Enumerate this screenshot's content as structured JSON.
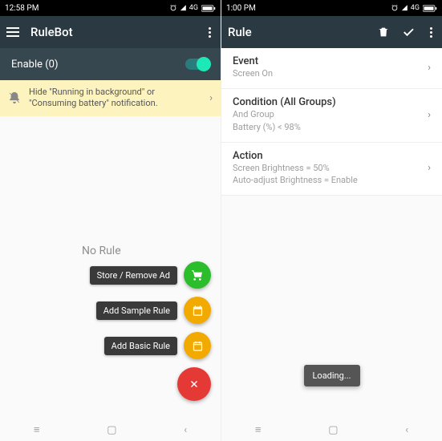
{
  "left": {
    "status_time": "12:58 PM",
    "status_net": "4G",
    "appbar_title": "RuleBot",
    "enable_label": "Enable (0)",
    "notice_text": "Hide \"Running in background\" or \"Consuming battery\" notification.",
    "no_rule": "No Rule",
    "fab": {
      "store": "Store / Remove Ad",
      "sample": "Add Sample Rule",
      "basic": "Add Basic Rule"
    }
  },
  "right": {
    "status_time": "1:00 PM",
    "status_net": "4G",
    "appbar_title": "Rule",
    "event": {
      "title": "Event",
      "sub": "Screen On"
    },
    "condition": {
      "title": "Condition (All Groups)",
      "sub1": "And Group",
      "sub2": "Battery (%) < 98%"
    },
    "action": {
      "title": "Action",
      "sub1": "Screen Brightness = 50%",
      "sub2": "Auto-adjust Brightness = Enable"
    },
    "toast": "Loading..."
  }
}
